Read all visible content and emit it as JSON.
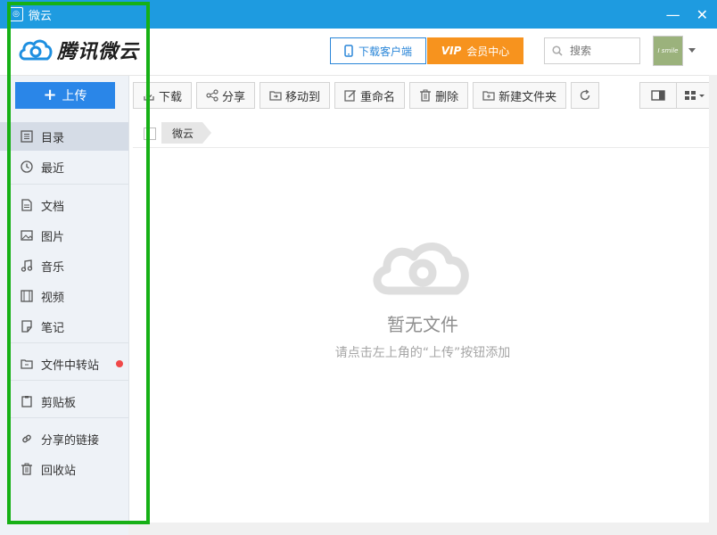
{
  "window": {
    "title": "微云",
    "minimize_label": "—",
    "close_label": "✕"
  },
  "header": {
    "brand": "腾讯微云",
    "download_client": "下载客户端",
    "vip_mark": "VIP",
    "vip_center": "会员中心",
    "search_placeholder": "搜索",
    "avatar_text": "I smile"
  },
  "sidebar": {
    "upload_label": "上传",
    "items": [
      {
        "label": "目录",
        "icon": "list-icon"
      },
      {
        "label": "最近",
        "icon": "clock-icon"
      },
      {
        "label": "文档",
        "icon": "document-icon"
      },
      {
        "label": "图片",
        "icon": "image-icon"
      },
      {
        "label": "音乐",
        "icon": "music-icon"
      },
      {
        "label": "视频",
        "icon": "film-icon"
      },
      {
        "label": "笔记",
        "icon": "note-icon"
      },
      {
        "label": "文件中转站",
        "icon": "transfer-icon"
      },
      {
        "label": "剪贴板",
        "icon": "clipboard-icon"
      },
      {
        "label": "分享的链接",
        "icon": "link-icon"
      },
      {
        "label": "回收站",
        "icon": "trash-icon"
      }
    ]
  },
  "toolbar": {
    "download": "下载",
    "share": "分享",
    "move_to": "移动到",
    "rename": "重命名",
    "delete": "删除",
    "new_folder": "新建文件夹"
  },
  "breadcrumb": {
    "root": "微云"
  },
  "empty_state": {
    "title": "暂无文件",
    "hint": "请点击左上角的“上传”按钮添加"
  },
  "colors": {
    "titlebar": "#1e9be0",
    "upload": "#2a86e8",
    "vip": "#f7931e",
    "highlight_frame": "#16b016",
    "badge": "#f04848"
  }
}
